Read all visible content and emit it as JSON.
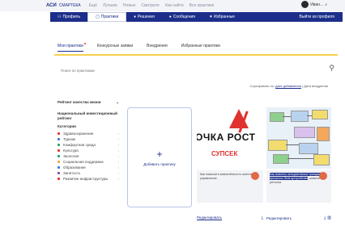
{
  "header": {
    "logo": "АСИ",
    "logo_sub": "СМАРТЕКА",
    "top_links": [
      "Ещё",
      "Лучшие",
      "Новые",
      "Смотрите",
      "Как найти",
      "Все практики"
    ],
    "user_name": "Иван..."
  },
  "nav": {
    "items": [
      {
        "label": "Профиль",
        "icon": "person-icon"
      },
      {
        "label": "Практики",
        "icon": "document-icon"
      },
      {
        "label": "Решения",
        "icon": "lightbulb-icon"
      },
      {
        "label": "Сообщения",
        "icon": "message-icon"
      },
      {
        "label": "Избранные",
        "icon": "heart-icon"
      }
    ],
    "logout": "Выйти из профиля"
  },
  "tabs": [
    "Мои практики",
    "Конкурсные заявки",
    "Внедрения",
    "Избранные практики"
  ],
  "search": {
    "placeholder": "Поиск по практикам"
  },
  "sort": {
    "label": "Сортировать по:",
    "value": "дате добавления",
    "extra": "| Дата внедрения"
  },
  "sidebar": {
    "rating_title": "Рейтинг качества жизни",
    "national_title": "Национальный инвестиционный рейтинг",
    "categories_title": "Категории",
    "categories": [
      {
        "label": "Здравоохранение",
        "color": "#e0322f"
      },
      {
        "label": "Туризм",
        "color": "#2f7bd9"
      },
      {
        "label": "Комфортная среда",
        "color": "#23a36b"
      },
      {
        "label": "Культура",
        "color": "#e0322f"
      },
      {
        "label": "Экология",
        "color": "#23a36b"
      },
      {
        "label": "Социальная поддержка",
        "color": "#f3a03a"
      },
      {
        "label": "Образование",
        "color": "#2f7bd9"
      },
      {
        "label": "Занятость",
        "color": "#8e44ad"
      },
      {
        "label": "Развитие инфраструктуры",
        "color": "#e0322f"
      }
    ]
  },
  "add_card": {
    "plus": "+",
    "label": "Добавить практику"
  },
  "cards": [
    {
      "image_text_1": "ОЧКА РОСТ",
      "image_text_2": "РОСТ",
      "image_text_3": "СУПСЕК",
      "description": "Как повысить вовлечённость жителей в управление",
      "vote": "Редактировать"
    },
    {
      "description_hl": "Как вовлечь инициативных граждан в процессы благоустройства",
      "description": "развития региона",
      "vote": "Редактировать"
    }
  ]
}
